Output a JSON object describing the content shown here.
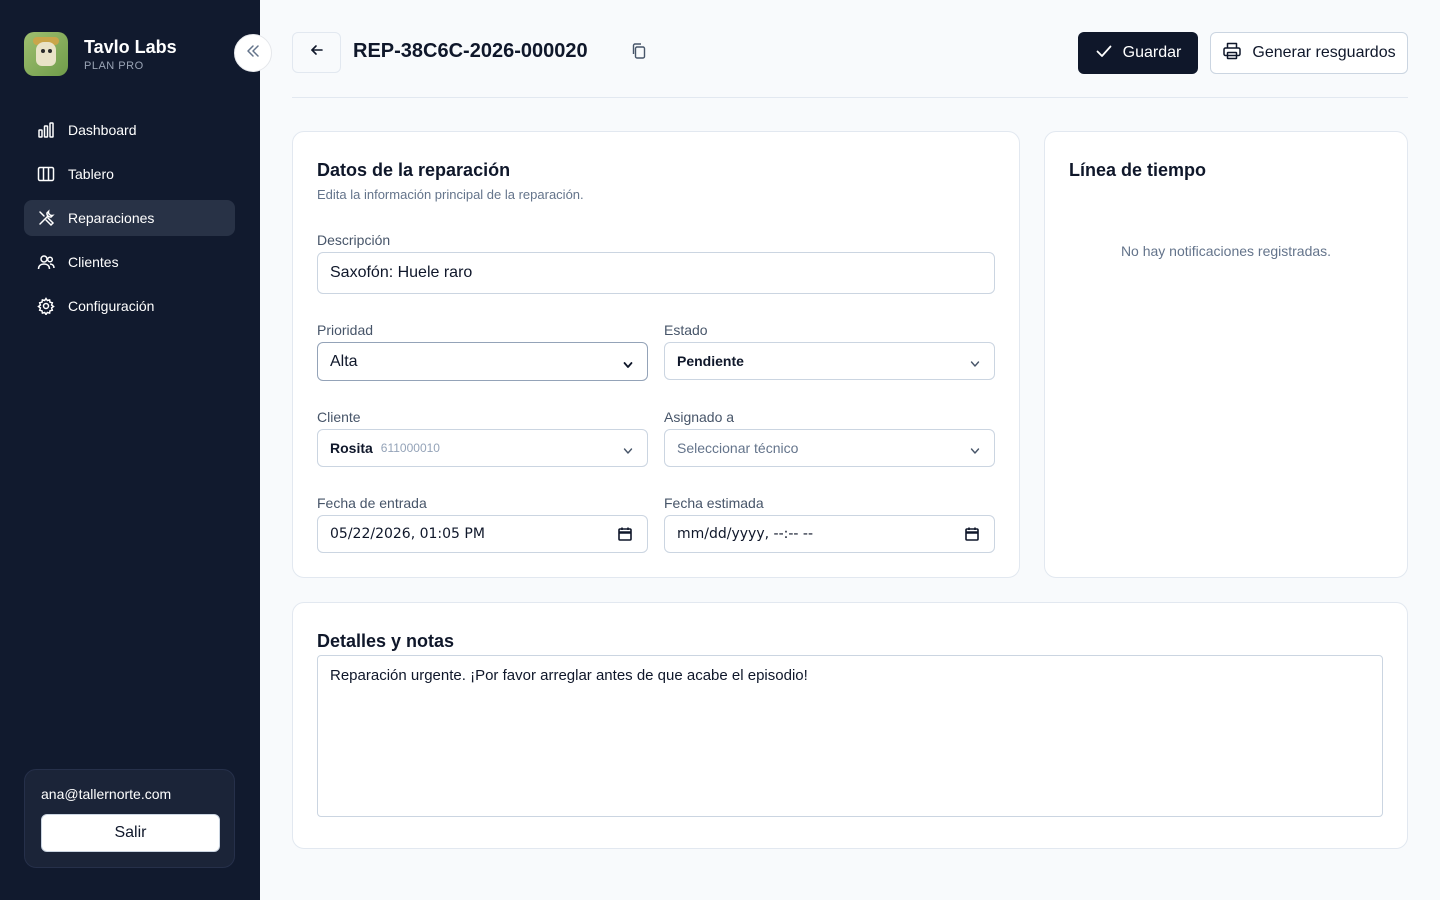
{
  "sidebar": {
    "brand_name": "Tavlo Labs",
    "brand_plan": "PLAN PRO",
    "items": [
      {
        "label": "Dashboard",
        "icon": "chart-bar-icon"
      },
      {
        "label": "Tablero",
        "icon": "columns-icon"
      },
      {
        "label": "Reparaciones",
        "icon": "tools-icon",
        "active": true
      },
      {
        "label": "Clientes",
        "icon": "users-icon"
      },
      {
        "label": "Configuración",
        "icon": "gear-icon"
      }
    ],
    "user_email": "ana@tallernorte.com",
    "logout_label": "Salir"
  },
  "header": {
    "repair_id": "REP-38C6C-2026-000020",
    "save_label": "Guardar",
    "print_label": "Generar resguardos"
  },
  "repair_form": {
    "title": "Datos de la reparación",
    "subtitle": "Edita la información principal de la reparación.",
    "description_label": "Descripción",
    "description_value": "Saxofón: Huele raro",
    "priority_label": "Prioridad",
    "priority_value": "Alta",
    "status_label": "Estado",
    "status_value": "Pendiente",
    "client_label": "Cliente",
    "client_name": "Rosita",
    "client_phone": "611000010",
    "assigned_label": "Asignado a",
    "assigned_placeholder": "Seleccionar técnico",
    "entry_date_label": "Fecha de entrada",
    "entry_date_value": "05/22/2026, 01:05 PM",
    "estimated_date_label": "Fecha estimada",
    "estimated_date_placeholder": "mm/dd/yyyy, --:-- --"
  },
  "timeline": {
    "title": "Línea de tiempo",
    "empty_text": "No hay notificaciones registradas."
  },
  "notes": {
    "title": "Detalles y notas",
    "value": "Reparación urgente. ¡Por favor arreglar antes de que acabe el episodio!"
  },
  "colors": {
    "sidebar_bg": "#111a2e",
    "primary_button": "#0f172a",
    "active_nav": "#283246"
  }
}
